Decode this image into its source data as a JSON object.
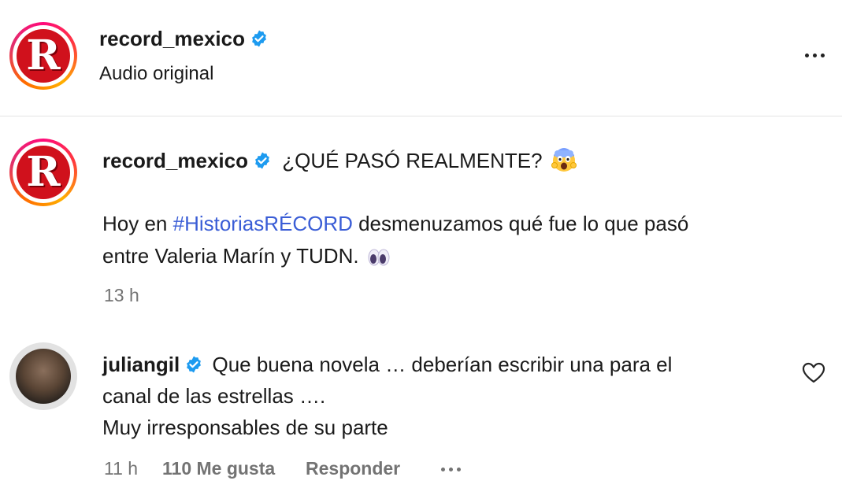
{
  "header": {
    "username": "record_mexico",
    "subtitle": "Audio original",
    "more_icon": "more-horizontal-icon"
  },
  "caption": {
    "username": "record_mexico",
    "title": "¿QUÉ PASÓ REALMENTE?",
    "title_emoji": "screaming-face-emoji",
    "line1_before": "Hoy en ",
    "hashtag": "#HistoriasRÉCORD",
    "line1_after": " desmenuzamos qué fue lo que pasó",
    "line2": "entre Valeria Marín y TUDN.",
    "line2_emoji": "eyes-emoji",
    "time": "13 h"
  },
  "comment": {
    "username": "juliangil",
    "line1": "Que buena novela … deberían escribir una para el",
    "line2": "canal de las estrellas ….",
    "line3": "Muy irresponsables de su parte",
    "time": "11 h",
    "likes": "110 Me gusta",
    "reply": "Responder",
    "like_icon": "heart-icon"
  },
  "logo_letter": "R",
  "colors": {
    "verified": "#1d9bf0",
    "hashtag": "#3a5dd6",
    "meta": "#737373",
    "logo_red": "#d0111c"
  }
}
